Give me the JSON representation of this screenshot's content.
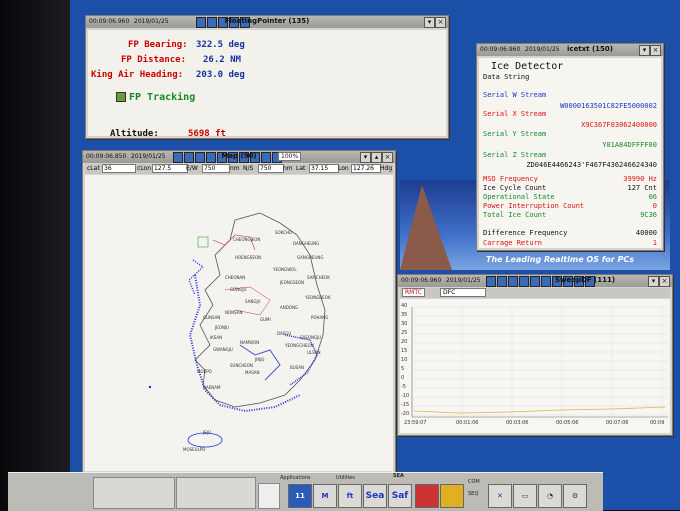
{
  "floating_pointer": {
    "title": "FloatingPointer (135)",
    "time": "00:09:06.960",
    "date": "2019/01/25",
    "rows": [
      {
        "label": "FP Bearing:",
        "value": "322.5 deg"
      },
      {
        "label": "FP Distance:",
        "value": "26.2 NM"
      },
      {
        "label": "King Air Heading:",
        "value": "203.0 deg"
      }
    ],
    "tracking_label": "FP Tracking",
    "altitude_label": "Altitude:",
    "altitude_value": "5698 ft"
  },
  "ice": {
    "title": "icetxt (150)",
    "time": "00:09:06.960",
    "date": "2019/01/25",
    "heading": "Ice Detector",
    "subheading": "Data String",
    "w_label": "Serial W Stream",
    "w_value": "W0000163501C82FE5000002",
    "x_label": "Serial X Stream",
    "x_value": "X9C367F03062400000",
    "y_label": "Serial Y Stream",
    "y_value": "Y01A84DFFFF00",
    "z_label": "Serial Z Stream",
    "z_value": "ZD046E4466243'F467F436246624340",
    "mso_label": "MSO Frequency",
    "mso_value": "39990 Hz",
    "cycle_label": "Ice Cycle Count",
    "cycle_value": "127 Cnt",
    "op_label": "Operational State",
    "op_value": "06",
    "pi_label": "Power Interruption Count",
    "pi_value": "0",
    "tic_label": "Total Ice Count",
    "tic_value": "9C36",
    "diff_label": "Difference Frequency",
    "diff_value": "40000",
    "cr_label": "Carrage Return",
    "cr_value": "1"
  },
  "map": {
    "title": "Map (90)",
    "time": "00:09:06.850",
    "date": "2019/01/25",
    "zoom": "100%",
    "clat_label": "cLat",
    "clat_value": "36",
    "clon_label": "cLon",
    "clon_value": "127.5",
    "ew_label": "E/W",
    "ew_value": "750",
    "nm1": "nm",
    "ns_label": "N/S",
    "ns_value": "750",
    "nm2": "nm",
    "lat_label": "Lat",
    "lat_value": "37.15",
    "lon_label": "Lon",
    "lon_value": "127.26",
    "hdg_label": "Hdg",
    "cities": [
      "CHEONGJEON",
      "DANGHEUNG",
      "HOENGSEON",
      "YEONGWOL",
      "SANGJU",
      "YEONGDEOK",
      "GUMI",
      "DAEGU",
      "JEONJU",
      "GWANGJU",
      "MOKPO",
      "SUNCHEON",
      "JINJU",
      "BUSAN",
      "ULSAN",
      "MASAN",
      "HAENAM",
      "GANGNEUNG",
      "JEONGSEON",
      "SAMCHEOK",
      "ANDONG",
      "POHANG",
      "GYEONGJU",
      "YEONGCHEON",
      "CHEONAN",
      "GONGJU",
      "NONSAN",
      "GUNSAN",
      "IKSAN",
      "NAMWON",
      "SOKCHO",
      "JEJU"
    ],
    "island_label": "MOSEULPO"
  },
  "graph": {
    "title": "SweepDF (111)",
    "time": "00:09:06.960",
    "date": "2019/01/25",
    "field1": "RMTC",
    "field2": "DFC",
    "y_ticks": [
      "40",
      "35",
      "30",
      "25",
      "20",
      "15",
      "10",
      "5",
      "0",
      "-5",
      "-10",
      "-15",
      "-20"
    ],
    "x_ticks": [
      "23:59:07",
      "00:01:06",
      "00:03:06",
      "00:05:06",
      "00:07:06",
      "00:09"
    ]
  },
  "desktop_tagline": "The Leading Realtime OS for PCs",
  "taskbar": {
    "applications_label": "Applications",
    "utilities_label": "Utilities",
    "sea_label": "SEA",
    "com_label": "COM",
    "seq_label": "SEQ",
    "apps": [
      "11",
      "M",
      "ft",
      "Sea",
      "Saf"
    ]
  },
  "colors": {
    "desktop": "#1b4fa8",
    "label_red": "#cc0000",
    "value_blue": "#1a2fa0",
    "accent_green": "#138a2a"
  }
}
